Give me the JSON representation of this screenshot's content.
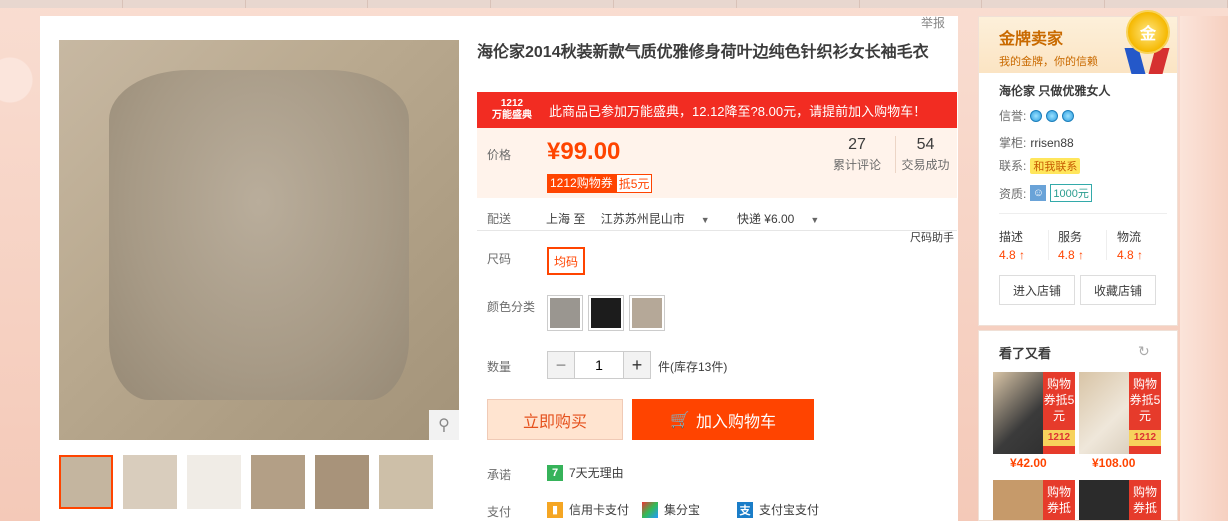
{
  "report_label": "举报",
  "product": {
    "title": "海伦家2014秋装新款气质优雅修身荷叶边纯色针织衫女长袖毛衣"
  },
  "promo": {
    "badge_top": "1212",
    "badge_bottom": "万能盛典",
    "text": "此商品已参加万能盛典，12.12降至?8.00元，请提前加入购物车！"
  },
  "price": {
    "label": "价格",
    "value": "¥99.00",
    "coupon_tag": "1212购物券",
    "coupon_value": "抵5元"
  },
  "stats": {
    "reviews_count": "27",
    "reviews_label": "累计评论",
    "sales_count": "54",
    "sales_label": "交易成功"
  },
  "shipping": {
    "label": "配送",
    "from": "上海 至",
    "to": "江苏苏州昆山市",
    "method": "快递 ¥6.00"
  },
  "size_helper": "尺码助手",
  "size": {
    "label": "尺码",
    "option": "均码"
  },
  "color": {
    "label": "颜色分类",
    "swatches": [
      "#9a9690",
      "#1c1c1c",
      "#b5a898"
    ]
  },
  "quantity": {
    "label": "数量",
    "value": "1",
    "stock": "件(库存13件)"
  },
  "actions": {
    "buy_now": "立即购买",
    "add_cart": "加入购物车"
  },
  "promise": {
    "label": "承诺",
    "text": "7天无理由",
    "icon": "7"
  },
  "payment": {
    "label": "支付",
    "methods": [
      "信用卡支付",
      "集分宝",
      "支付宝支付"
    ]
  },
  "seller": {
    "title": "金牌卖家",
    "subtitle": "我的金牌，你的信赖",
    "medal": "金",
    "shop_name": "海伦家 只做优雅女人",
    "credit_label": "信誉:",
    "owner_label": "掌柜:",
    "owner": "rrisen88",
    "contact_label": "联系:",
    "contact_btn": "和我联系",
    "qualification_label": "资质:",
    "qualification_tag": "1000元",
    "ratings": [
      {
        "label": "描述",
        "score": "4.8"
      },
      {
        "label": "服务",
        "score": "4.8"
      },
      {
        "label": "物流",
        "score": "4.8"
      }
    ],
    "enter_shop": "进入店铺",
    "fav_shop": "收藏店铺"
  },
  "also_viewed": {
    "title": "看了又看",
    "items": [
      {
        "tag": "购物券抵5元",
        "badge": "1212",
        "price": "¥42.00"
      },
      {
        "tag": "购物券抵5元",
        "badge": "1212",
        "price": "¥108.00"
      },
      {
        "tag": "购物券抵"
      },
      {
        "tag": "购物券抵"
      }
    ]
  },
  "colors": {
    "accent": "#ff4400",
    "promo_red": "#f22c22",
    "gold": "#c96a00"
  }
}
